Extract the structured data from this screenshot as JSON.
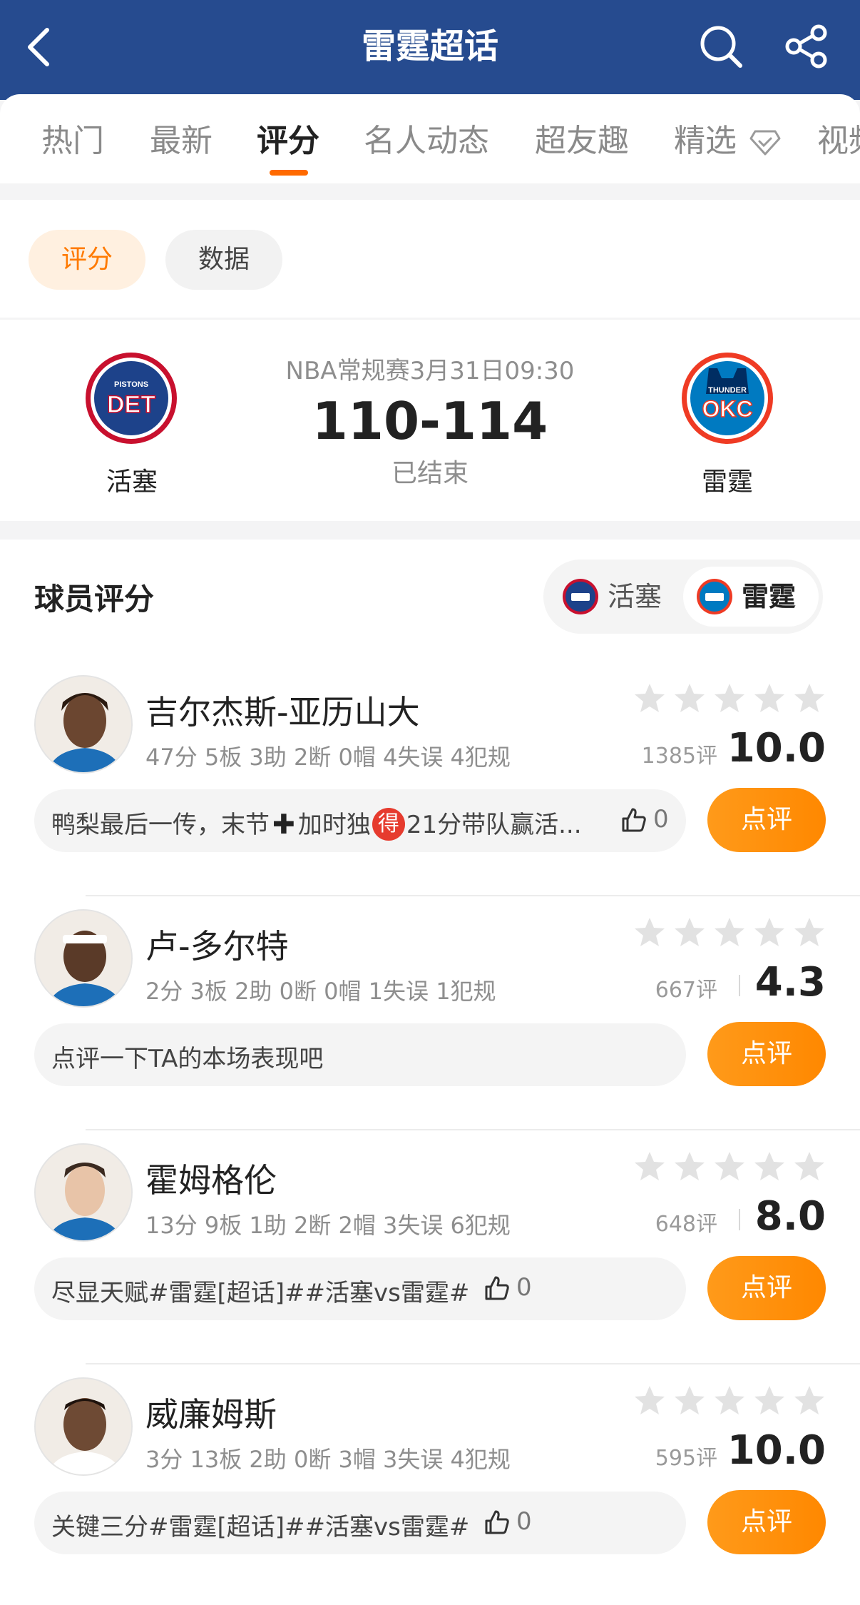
{
  "header": {
    "title": "雷霆超话"
  },
  "tabs": [
    {
      "label": "热门",
      "active": false
    },
    {
      "label": "最新",
      "active": false
    },
    {
      "label": "评分",
      "active": true
    },
    {
      "label": "名人动态",
      "active": false
    },
    {
      "label": "超友趣",
      "active": false
    },
    {
      "label": "精选",
      "active": false
    },
    {
      "label": "视频",
      "active": false
    }
  ],
  "filters": [
    {
      "label": "评分",
      "active": true
    },
    {
      "label": "数据",
      "active": false
    }
  ],
  "match": {
    "meta": "NBA常规赛3月31日09:30",
    "score": "110-114",
    "status": "已结束",
    "home": {
      "name": "活塞",
      "logo_top": "PISTONS",
      "logo_abbr": "DET",
      "color": "#1d428a",
      "accent": "#c8102e"
    },
    "away": {
      "name": "雷霆",
      "logo_top": "THUNDER",
      "logo_abbr": "OKC",
      "color": "#007ac1",
      "accent": "#ef3b24"
    }
  },
  "ratings": {
    "title": "球员评分",
    "team_switch": [
      {
        "label": "活塞",
        "active": false
      },
      {
        "label": "雷霆",
        "active": true
      }
    ],
    "review_label": "点评",
    "players": [
      {
        "name": "吉尔杰斯-亚历山大",
        "stats": "47分 5板 3助 2断 0帽 4失误 4犯规",
        "rating_count": "1385评",
        "score": "10.0",
        "comment_pre": "鸭梨最后一传，末节",
        "comment_mid": "加时独",
        "comment_badge": "得",
        "comment_post": "21分带队赢活...",
        "likes": "0",
        "skin": "#6b4630"
      },
      {
        "name": "卢-多尔特",
        "stats": "2分 3板 2助 0断 0帽 1失误 1犯规",
        "rating_count": "667评",
        "score": "4.3",
        "comment_text": "点评一下TA的本场表现吧",
        "skin": "#5a3a28"
      },
      {
        "name": "霍姆格伦",
        "stats": "13分 9板 1助 2断 2帽 3失误 6犯规",
        "rating_count": "648评",
        "score": "8.0",
        "comment_text": "尽显天赋#雷霆[超话]##活塞vs雷霆#",
        "likes": "0",
        "skin": "#e8c4a8"
      },
      {
        "name": "威廉姆斯",
        "stats": "3分 13板 2助 0断 3帽 3失误 4犯规",
        "rating_count": "595评",
        "score": "10.0",
        "comment_text": "关键三分#雷霆[超话]##活塞vs雷霆#",
        "likes": "0",
        "skin": "#6e4a34"
      }
    ]
  },
  "colors": {
    "header_bg": "#264b8f",
    "accent_orange": "#ff8800",
    "star_empty": "#e2e2e2"
  }
}
